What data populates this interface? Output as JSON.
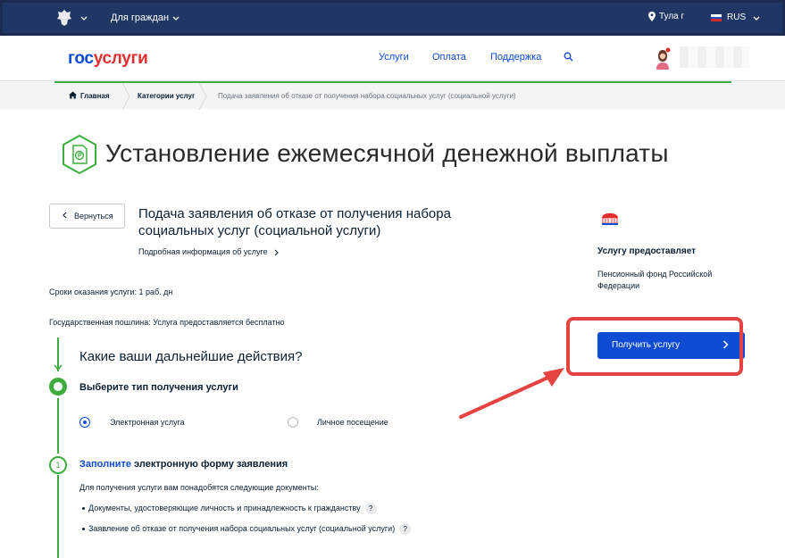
{
  "topbar": {
    "audience_label": "Для граждан",
    "location": "Тула г",
    "language": "RUS"
  },
  "header": {
    "logo_part1": "гос",
    "logo_part2": "услуги",
    "nav": [
      "Услуги",
      "Оплата",
      "Поддержка"
    ]
  },
  "breadcrumb": {
    "home": "Главная",
    "categories": "Категории услуг",
    "current": "Подача заявления об отказе от получения набора социальных услуг (социальной услуги)"
  },
  "page": {
    "title": "Установление ежемесячной денежной выплаты",
    "back_label": "Вернуться",
    "service_name": "Подача заявления об отказе от получения набора социальных услуг (социальной услуги)",
    "detail_link": "Подробная информация об услуге",
    "terms": "Сроки оказания услуги: 1 раб. дн",
    "fee": "Государственная пошлина: Услуга предоставляется бесплатно"
  },
  "provider": {
    "heading": "Услугу предоставляет",
    "name": "Пенсионный фонд Российской Федерации",
    "get_service_label": "Получить услугу"
  },
  "steps": {
    "question": "Какие ваши дальнейшие действия?",
    "step1_title": "Выберите тип получения услуги",
    "option_electronic": "Электронная услуга",
    "option_visit": "Личное посещение",
    "selected_option": "Электронная услуга",
    "step2_number": "1",
    "step2_link": "Заполните",
    "step2_rest": " электронную форму заявления",
    "docs_intro": "Для получения услуги вам понадобятся следующие документы:",
    "documents": [
      "Документы, удостоверяющие личность и принадлежность к гражданству",
      "Заявление об отказе от получения набора социальных услуг (социальной услуги)"
    ],
    "help_glyph": "?"
  },
  "colors": {
    "topbar": "#203766",
    "brand_blue": "#0d4cd3",
    "brand_red": "#e12f2f",
    "step_green": "#3dad3d",
    "highlight_red": "#e54242"
  }
}
